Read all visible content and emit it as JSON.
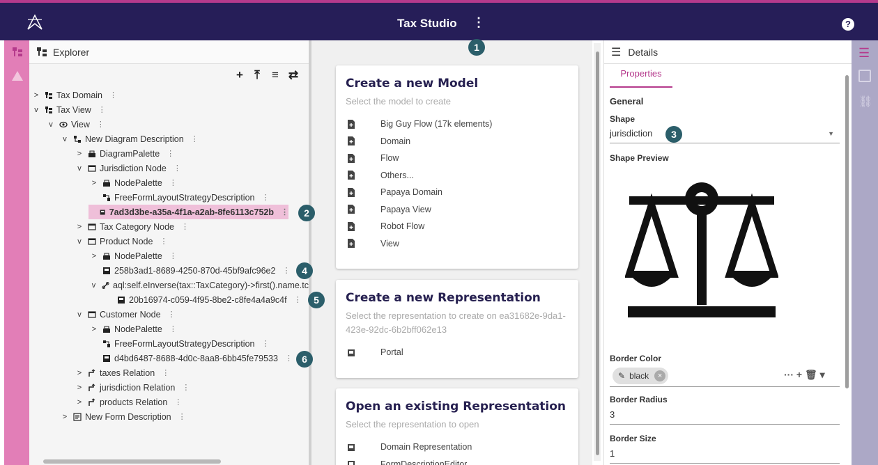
{
  "header": {
    "title": "Tax Studio",
    "menu_icon": "kebab-icon",
    "help_icon": "help-icon",
    "help_glyph": "?"
  },
  "colors": {
    "header_bg": "#261e58",
    "accent": "#b53a8c",
    "left_rail": "#e27eb7",
    "right_rail": "#aca8c6",
    "selection": "#efbfd9",
    "badge": "#2b5e6a"
  },
  "explorer": {
    "title": "Explorer",
    "toolbar": [
      "+",
      "⤒",
      "≡",
      "⇄"
    ],
    "tree": [
      {
        "label": "Tax Domain",
        "chevron": ">"
      },
      {
        "label": "Tax View",
        "chevron": "v"
      },
      {
        "label": "View",
        "chevron": "v"
      },
      {
        "label": "New Diagram Description",
        "chevron": "v"
      },
      {
        "label": "DiagramPalette",
        "chevron": ">"
      },
      {
        "label": "Jurisdiction Node",
        "chevron": "v"
      },
      {
        "label": "NodePalette",
        "chevron": ">"
      },
      {
        "label": "FreeFormLayoutStrategyDescription",
        "chevron": ""
      },
      {
        "label": "7ad3d3be-a35a-4f1a-a2ab-8fe6113c752b",
        "chevron": ""
      },
      {
        "label": "Tax Category Node",
        "chevron": ">"
      },
      {
        "label": "Product Node",
        "chevron": "v"
      },
      {
        "label": "NodePalette",
        "chevron": ">"
      },
      {
        "label": "258b3ad1-8689-4250-870d-45bf9afc96e2",
        "chevron": ""
      },
      {
        "label": "aql:self.eInverse(tax::TaxCategory)->first().name.tc",
        "chevron": "v"
      },
      {
        "label": "20b16974-c059-4f95-8be2-c8fe4a4a9c4f",
        "chevron": ""
      },
      {
        "label": "Customer Node",
        "chevron": "v"
      },
      {
        "label": "NodePalette",
        "chevron": ">"
      },
      {
        "label": "FreeFormLayoutStrategyDescription",
        "chevron": ""
      },
      {
        "label": "d4bd6487-8688-4d0c-8aa8-6bb45fe79533",
        "chevron": ""
      },
      {
        "label": "taxes Relation",
        "chevron": ">"
      },
      {
        "label": "jurisdiction Relation",
        "chevron": ">"
      },
      {
        "label": "products Relation",
        "chevron": ">"
      },
      {
        "label": "New Form Description",
        "chevron": ">"
      }
    ]
  },
  "center": {
    "new_model": {
      "title": "Create a new Model",
      "subtitle": "Select the model to create",
      "items": [
        "Big Guy Flow (17k elements)",
        "Domain",
        "Flow",
        "Others...",
        "Papaya Domain",
        "Papaya View",
        "Robot Flow",
        "View"
      ]
    },
    "new_representation": {
      "title": "Create a new Representation",
      "subtitle": "Select the representation to create on ea31682e-9da1-423e-92dc-6b2bff062e13",
      "items": [
        "Portal"
      ]
    },
    "open_representation": {
      "title": "Open an existing Representation",
      "subtitle": "Select the representation to open",
      "items": [
        "Domain Representation",
        "FormDescriptionEditor"
      ]
    }
  },
  "details": {
    "title": "Details",
    "tab": "Properties",
    "section": "General",
    "shape_label": "Shape",
    "shape_value": "jurisdiction",
    "preview_label": "Shape Preview",
    "border_color_label": "Border Color",
    "border_color_value": "black",
    "chip_actions": "··· + 🗑 ▾",
    "border_radius_label": "Border Radius",
    "border_radius_value": "3",
    "border_size_label": "Border Size",
    "border_size_value": "1"
  },
  "badges": [
    "1",
    "2",
    "3",
    "4",
    "5",
    "6"
  ]
}
